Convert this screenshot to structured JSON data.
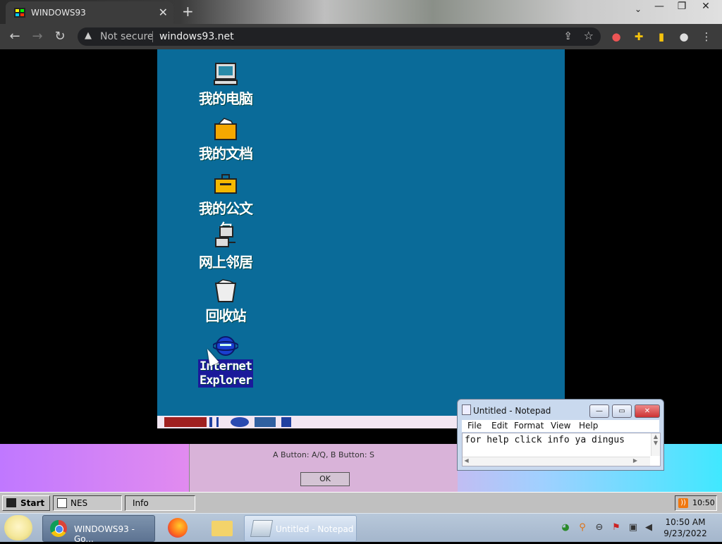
{
  "browser": {
    "tab_title": "WINDOWS93",
    "tab_close": "✕",
    "new_tab": "+",
    "security_label": "Not secure",
    "url": "windows93.net",
    "window_controls": [
      "—",
      "❐",
      "✕"
    ]
  },
  "desktop": {
    "icons": [
      {
        "label": "我的电脑",
        "icon": "computer-icon"
      },
      {
        "label": "我的文档",
        "icon": "documents-folder-icon"
      },
      {
        "label": "我的公文包",
        "icon": "briefcase-icon"
      },
      {
        "label": "网上邻居",
        "icon": "network-icon"
      },
      {
        "label": "回收站",
        "icon": "recycle-bin-icon"
      },
      {
        "label": "Internet Explorer",
        "label_line1": "Internet",
        "label_line2": "Explorer",
        "icon": "internet-explorer-icon"
      }
    ]
  },
  "nes_dialog": {
    "hint": "A Button: A/Q, B Button: S",
    "ok_label": "OK"
  },
  "notepad": {
    "title": "Untitled - Notepad",
    "menu": [
      "File",
      "Edit",
      "Format",
      "View",
      "Help"
    ],
    "content": "for help click info ya dingus",
    "buttons": {
      "minimize": "—",
      "maximize": "▭",
      "close": "✕"
    }
  },
  "w93_taskbar": {
    "start_label": "Start",
    "tasks": [
      "NES Emula...",
      "Info"
    ],
    "clock": "10:50"
  },
  "os_taskbar": {
    "tasks": [
      {
        "label": "WINDOWS93 - Go...",
        "icon": "chrome-icon"
      },
      {
        "label": "",
        "icon": "firefox-icon"
      },
      {
        "label": "",
        "icon": "folder-icon"
      },
      {
        "label": "Untitled - Notepad",
        "icon": "notepad-icon"
      }
    ],
    "time": "10:50 AM",
    "date": "9/23/2022"
  },
  "colors": {
    "desktop_bg": "#0a6b99",
    "browser_toolbar": "#3c3c3c",
    "w93_taskbar": "#c0c0c0"
  }
}
